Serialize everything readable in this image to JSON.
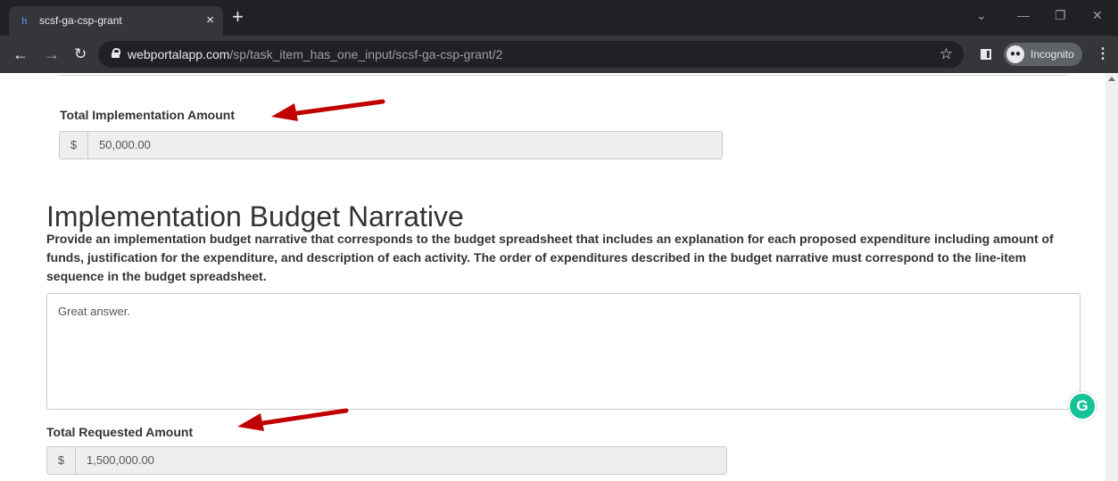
{
  "browser": {
    "tab_title": "scsf-ga-csp-grant",
    "tab_favicon": "h",
    "tab_close": "×",
    "new_tab": "+",
    "url_domain": "webportalapp.com",
    "url_path": "/sp/task_item_has_one_input/scsf-ga-csp-grant/2",
    "incognito_label": "Incognito"
  },
  "form": {
    "total_implementation": {
      "label": "Total Implementation Amount",
      "currency": "$",
      "value": "50,000.00"
    },
    "budget_narrative": {
      "title": "Implementation Budget Narrative",
      "prompt": "Provide an implementation budget narrative that corresponds to the budget spreadsheet that includes an explanation for each proposed expenditure including amount of funds, justification for the expenditure, and description of each activity. The order of expenditures described in the budget narrative must correspond to the line-item sequence in the budget spreadsheet.",
      "answer": "Great answer."
    },
    "total_requested": {
      "label": "Total Requested Amount",
      "currency": "$",
      "value": "1,500,000.00"
    }
  },
  "annotations": {
    "arrow_color": "#c00000"
  },
  "grammarly_badge": "G"
}
